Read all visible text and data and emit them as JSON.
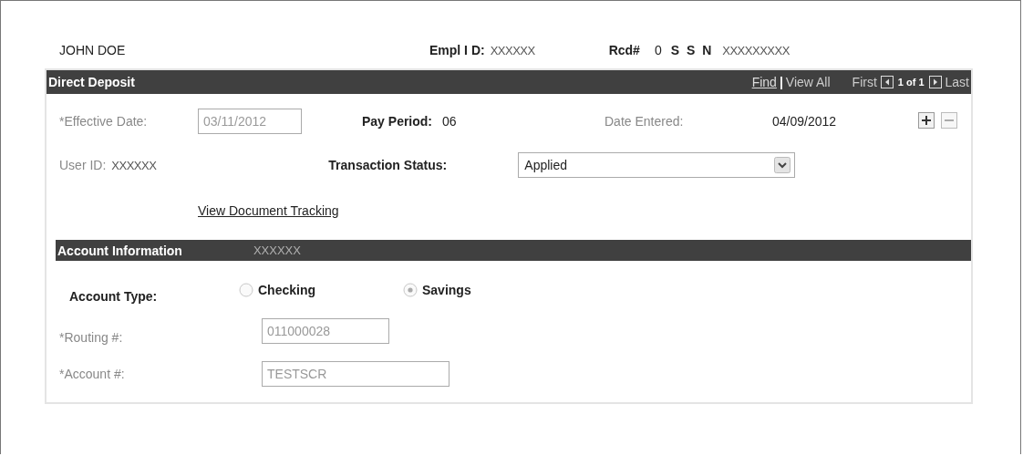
{
  "header": {
    "name": "JOHN DOE",
    "empl_id_label": "Empl I D:",
    "empl_id": "XXXXXX",
    "rcd_label": "Rcd#",
    "rcd": "0",
    "ssn_label": "S S N",
    "ssn": "XXXXXXXXX"
  },
  "direct_deposit": {
    "title": "Direct Deposit",
    "find": "Find",
    "separator": "|",
    "view_all": "View All",
    "first": "First",
    "counter": "1 of 1",
    "last": "Last",
    "effective_date_label": "*Effective Date:",
    "effective_date": {
      "value": "03/11/2012",
      "disabled": true
    },
    "pay_period_label": "Pay Period:",
    "pay_period": "06",
    "date_entered_label": "Date Entered:",
    "date_entered": "04/09/2012",
    "user_id_label": "User ID:",
    "user_id": "XXXXXX",
    "transaction_status_label": "Transaction Status:",
    "transaction_status": "Applied",
    "view_document_tracking": "View Document Tracking"
  },
  "account_information": {
    "title": "Account Information",
    "overlay_text": "XXXXXX",
    "account_type_label": "Account Type:",
    "account_types": [
      {
        "label": "Checking",
        "selected": false
      },
      {
        "label": "Savings",
        "selected": true
      }
    ],
    "routing_label": "*Routing #:",
    "routing": {
      "value": "011000028",
      "disabled": true
    },
    "account_label": "*Account #:",
    "account": {
      "value": "TESTSCR",
      "disabled": true
    }
  }
}
